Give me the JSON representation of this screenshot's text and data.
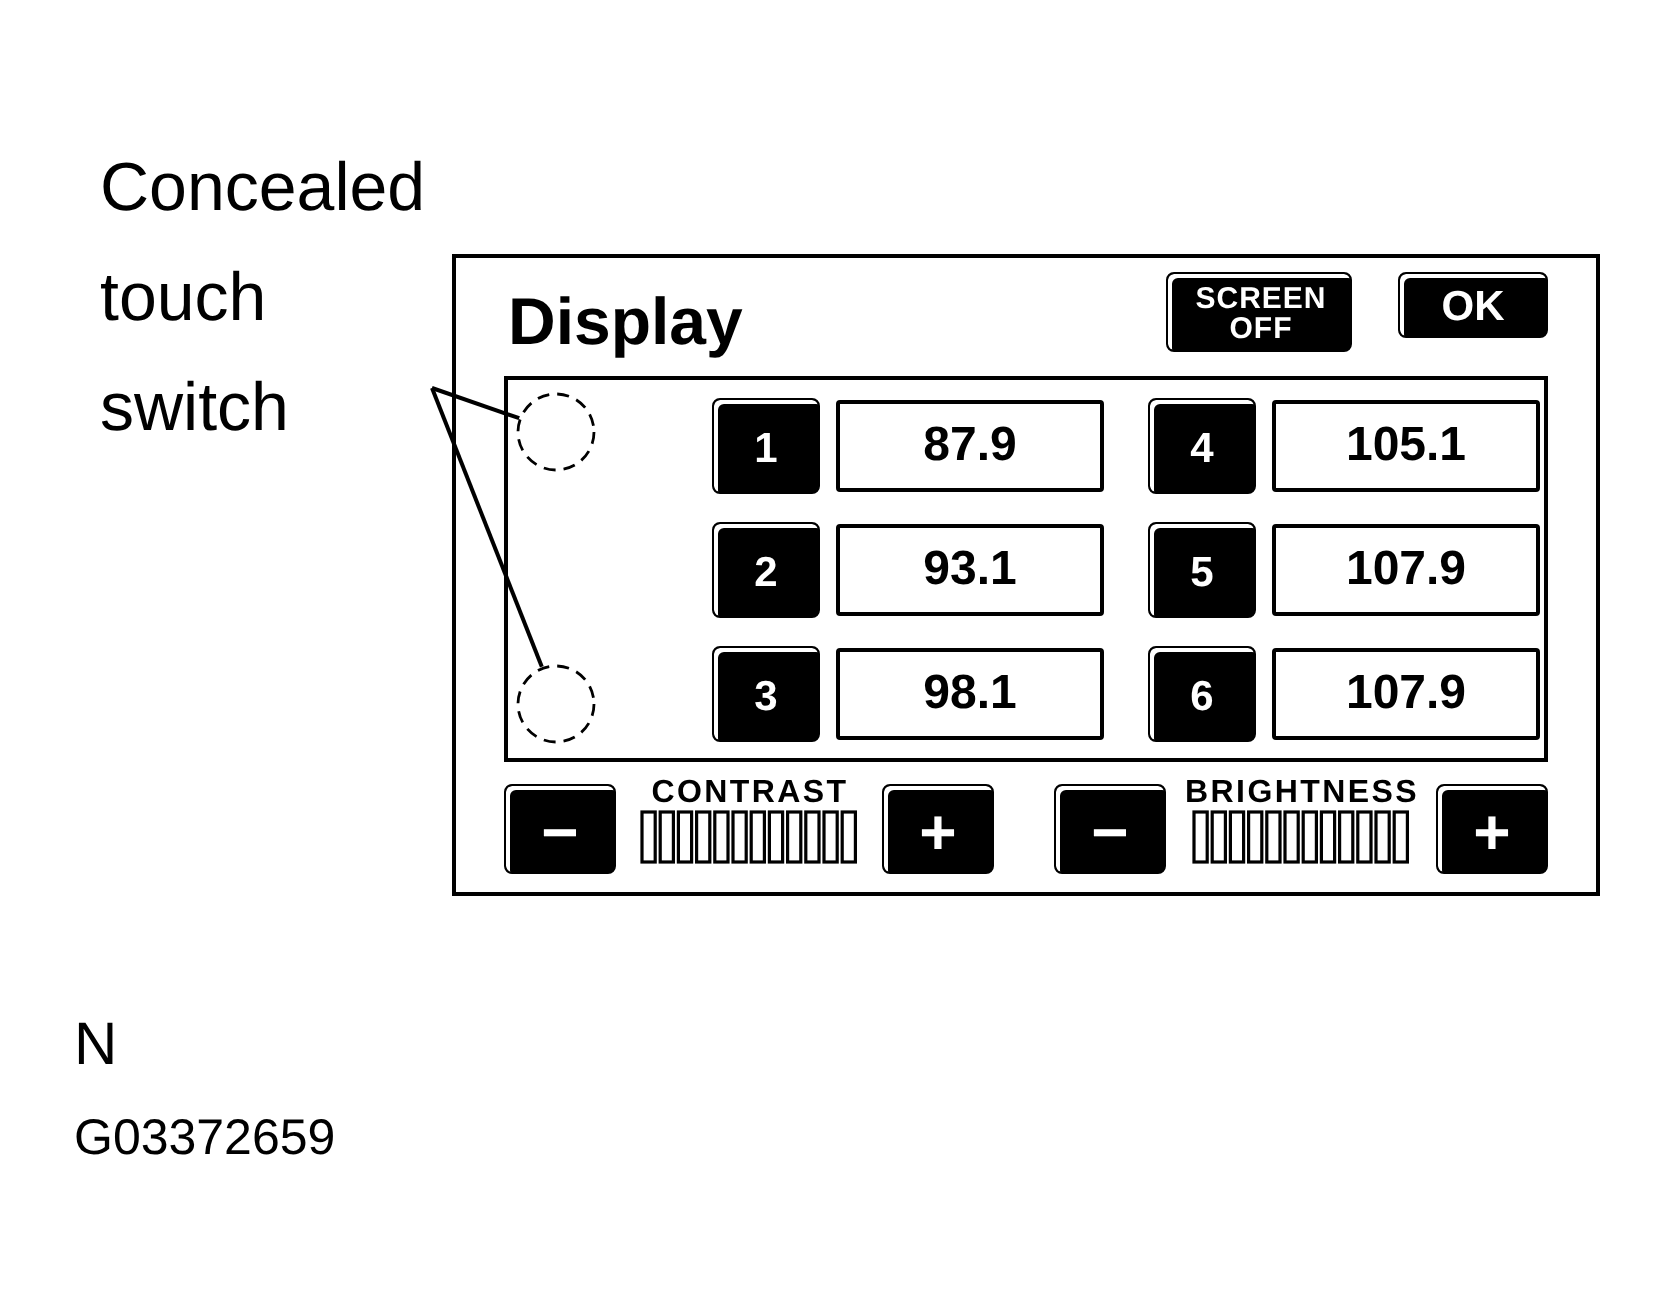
{
  "callout": {
    "label": "Concealed touch switch"
  },
  "display": {
    "title": "Display",
    "buttons": [
      {
        "label": "SCREEN OFF"
      },
      {
        "label": "OK"
      }
    ],
    "presets": [
      {
        "number": "1",
        "frequency": "87.9"
      },
      {
        "number": "2",
        "frequency": "93.1"
      },
      {
        "number": "3",
        "frequency": "98.1"
      },
      {
        "number": "4",
        "frequency": "105.1"
      },
      {
        "number": "5",
        "frequency": "107.9"
      },
      {
        "number": "6",
        "frequency": "107.9"
      }
    ],
    "adjusters": [
      {
        "label": "CONTRAST",
        "decrease": "−",
        "increase": "+"
      },
      {
        "label": "BRIGHTNESS",
        "decrease": "−",
        "increase": "+"
      }
    ]
  },
  "footer": {
    "mark": "N",
    "code": "G03372659"
  }
}
